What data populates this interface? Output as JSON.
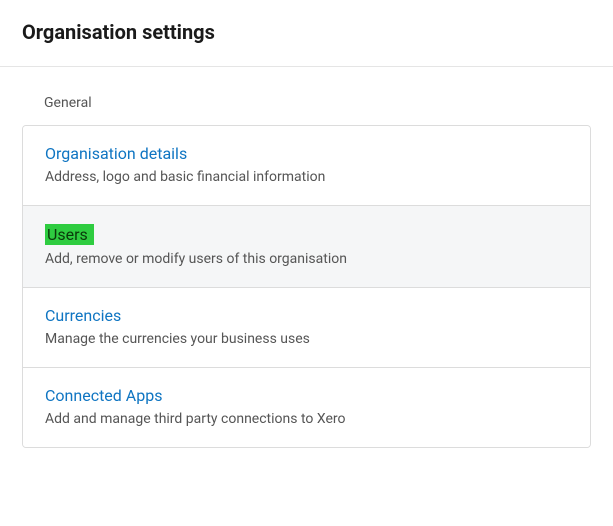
{
  "header": {
    "title": "Organisation settings"
  },
  "section": {
    "label": "General"
  },
  "items": [
    {
      "title": "Organisation details",
      "desc": "Address, logo and basic financial information",
      "highlighted": false
    },
    {
      "title": "Users",
      "desc": "Add, remove or modify users of this organisation",
      "highlighted": true
    },
    {
      "title": "Currencies",
      "desc": "Manage the currencies your business uses",
      "highlighted": false
    },
    {
      "title": "Connected Apps",
      "desc": "Add and manage third party connections to Xero",
      "highlighted": false
    }
  ]
}
